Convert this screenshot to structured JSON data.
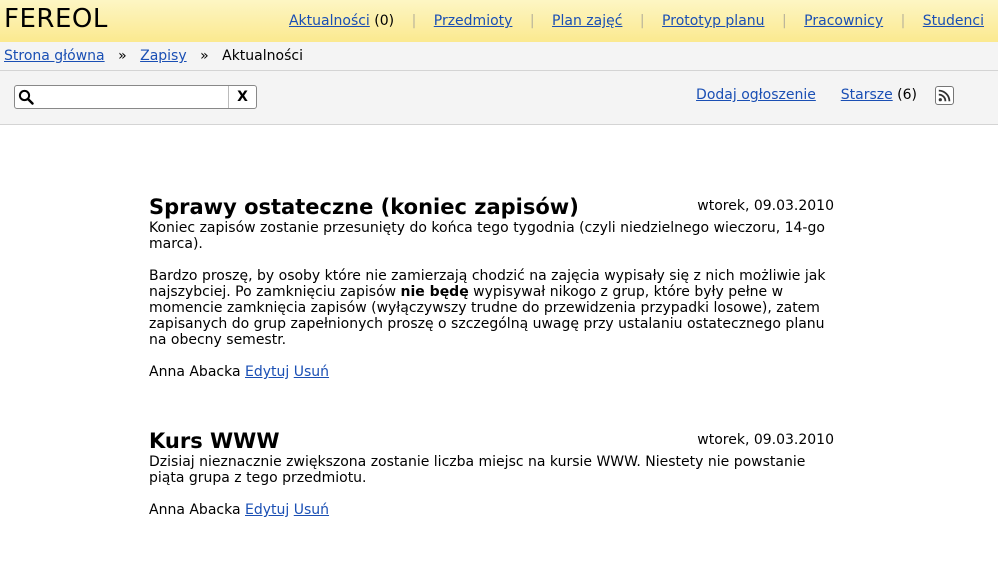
{
  "app": {
    "title": "FEREOL"
  },
  "nav": {
    "items": [
      {
        "label": "Aktualności",
        "count": "(0)"
      },
      {
        "label": "Przedmioty"
      },
      {
        "label": "Plan zajęć"
      },
      {
        "label": "Prototyp planu"
      },
      {
        "label": "Pracownicy"
      },
      {
        "label": "Studenci"
      }
    ],
    "separator": "|"
  },
  "breadcrumb": {
    "items": [
      "Strona główna",
      "Zapisy",
      "Aktualności"
    ],
    "separator": "»"
  },
  "toolbar": {
    "search_value": "",
    "clear_label": "X",
    "add_label": "Dodaj ogłoszenie",
    "older_label": "Starsze",
    "older_count": "(6)",
    "rss_icon": "rss-icon"
  },
  "news": [
    {
      "title": "Sprawy ostateczne (koniec zapisów)",
      "date": "wtorek, 09.03.2010",
      "p1": "Koniec zapisów zostanie przesunięty do końca tego tygodnia (czyli niedzielnego wieczoru, 14-go marca).",
      "p2a": "Bardzo proszę, by osoby które nie zamierzają chodzić na zajęcia wypisały się z nich możliwie jak najszybciej. Po zamknięciu zapisów ",
      "p2b": "nie będę",
      "p2c": " wypisywał nikogo z grup, które były pełne w momencie zamknięcia zapisów (wyłączywszy trudne do przewidzenia przypadki losowe), zatem zapisanych do grup zapełnionych proszę o szczególną uwagę przy ustalaniu ostatecznego planu na obecny semestr.",
      "author": "Anna Abacka",
      "edit_label": "Edytuj",
      "delete_label": "Usuń"
    },
    {
      "title": "Kurs WWW",
      "date": "wtorek, 09.03.2010",
      "p1": "Dzisiaj nieznacznie zwiększona zostanie liczba miejsc na kursie WWW. Niestety nie powstanie piąta grupa z tego przedmiotu.",
      "author": "Anna Abacka",
      "edit_label": "Edytuj",
      "delete_label": "Usuń"
    }
  ],
  "colors": {
    "header_bg": "#fbe98f",
    "link": "#1a4fb4",
    "bar_bg": "#f4f4f4"
  }
}
